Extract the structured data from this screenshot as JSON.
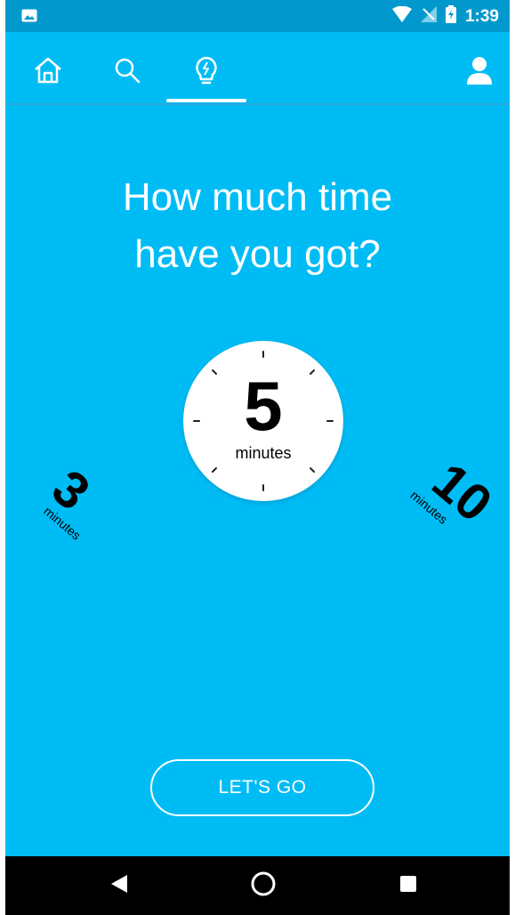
{
  "status_bar": {
    "time": "1:39",
    "icons": [
      "image-notification-icon",
      "wifi-icon",
      "signal-icon",
      "battery-icon"
    ]
  },
  "top_nav": {
    "items": [
      {
        "icon": "home-icon"
      },
      {
        "icon": "search-icon"
      },
      {
        "icon": "lightbulb-bolt-icon",
        "active": true
      },
      {
        "icon": "profile-icon"
      }
    ]
  },
  "main": {
    "headline_line1": "How much time",
    "headline_line2": "have you got?",
    "dial": {
      "value": "5",
      "unit": "minutes"
    },
    "options": [
      {
        "value": "3",
        "unit": "minutes"
      },
      {
        "value": "10",
        "unit": "minutes"
      }
    ],
    "cta_label": "LET'S GO"
  },
  "system_nav": {
    "buttons": [
      "back-icon",
      "home-circle-icon",
      "recents-icon"
    ]
  },
  "colors": {
    "background": "#00bcf5",
    "status_bar": "#0199cd",
    "foreground": "#ffffff",
    "system_nav": "#000000"
  }
}
